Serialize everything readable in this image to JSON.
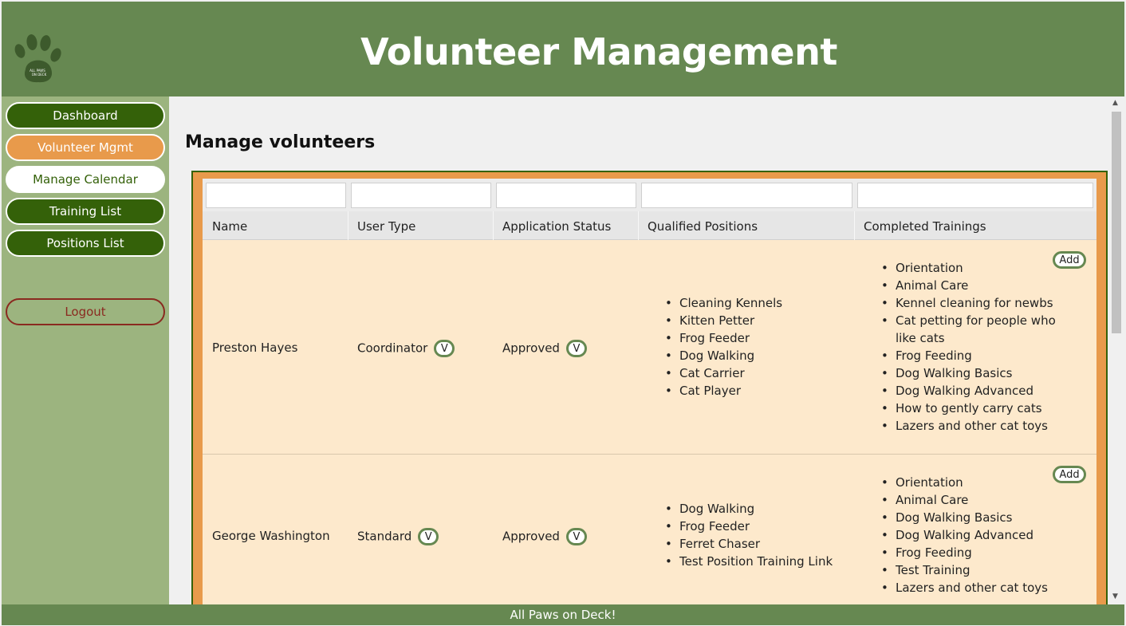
{
  "header": {
    "title": "Volunteer Management",
    "logo_text": "ALL PAWS ON DECK"
  },
  "sidebar": {
    "items": [
      {
        "label": "Dashboard"
      },
      {
        "label": "Volunteer Mgmt"
      },
      {
        "label": "Manage Calendar"
      },
      {
        "label": "Training List"
      },
      {
        "label": "Positions List"
      }
    ],
    "logout_label": "Logout"
  },
  "main": {
    "title": "Manage volunteers"
  },
  "table": {
    "columns": [
      "Name",
      "User Type",
      "Application Status",
      "Qualified Positions",
      "Completed Trainings"
    ],
    "rows": [
      {
        "name": "Preston Hayes",
        "user_type": "Coordinator",
        "status": "Approved",
        "v_label": "V",
        "add_label": "Add",
        "positions": [
          "Cleaning Kennels",
          "Kitten Petter",
          "Frog Feeder",
          "Dog Walking",
          "Cat Carrier",
          "Cat Player"
        ],
        "trainings": [
          "Orientation",
          "Animal Care",
          "Kennel cleaning for newbs",
          "Cat petting for people who like cats",
          "Frog Feeding",
          "Dog Walking Basics",
          "Dog Walking Advanced",
          "How to gently carry cats",
          "Lazers and other cat toys"
        ]
      },
      {
        "name": "George Washington",
        "user_type": "Standard",
        "status": "Approved",
        "v_label": "V",
        "add_label": "Add",
        "positions": [
          "Dog Walking",
          "Frog Feeder",
          "Ferret Chaser",
          "Test Position Training Link"
        ],
        "trainings": [
          "Orientation",
          "Animal Care",
          "Dog Walking Basics",
          "Dog Walking Advanced",
          "Frog Feeding",
          "Test Training",
          "Lazers and other cat toys"
        ]
      }
    ]
  },
  "footer": {
    "text": "All Paws on Deck!"
  },
  "colors": {
    "header": "#668851",
    "sidebar": "#9cb47f",
    "nav_dark": "#346109",
    "accent_orange": "#e89a4b",
    "row_bg": "#fde9cc",
    "logout": "#8a2a20"
  }
}
